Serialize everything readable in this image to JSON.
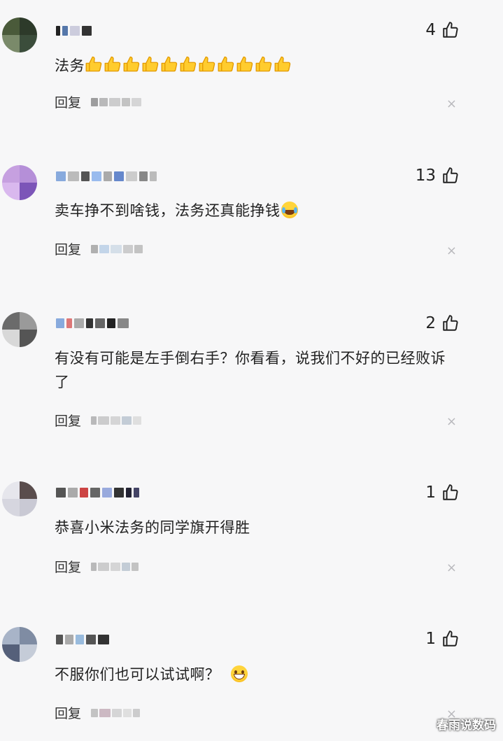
{
  "reply_label": "回复",
  "close_glyph": "×",
  "watermark": "春雨说数码",
  "comments": [
    {
      "likes": "4",
      "text": "法务",
      "emoji": "thumbs-up-emoji",
      "emoji_count": 11
    },
    {
      "likes": "13",
      "text": "卖车挣不到啥钱，法务还真能挣钱",
      "emoji": "laughing-crying-emoji"
    },
    {
      "likes": "2",
      "text": "有没有可能是左手倒右手？你看看，说我们不好的已经败诉了"
    },
    {
      "likes": "1",
      "text": "恭喜小米法务的同学旗开得胜"
    },
    {
      "likes": "1",
      "text": "不服你们也可以试试啊？",
      "emoji": "grinning-emoji"
    }
  ]
}
